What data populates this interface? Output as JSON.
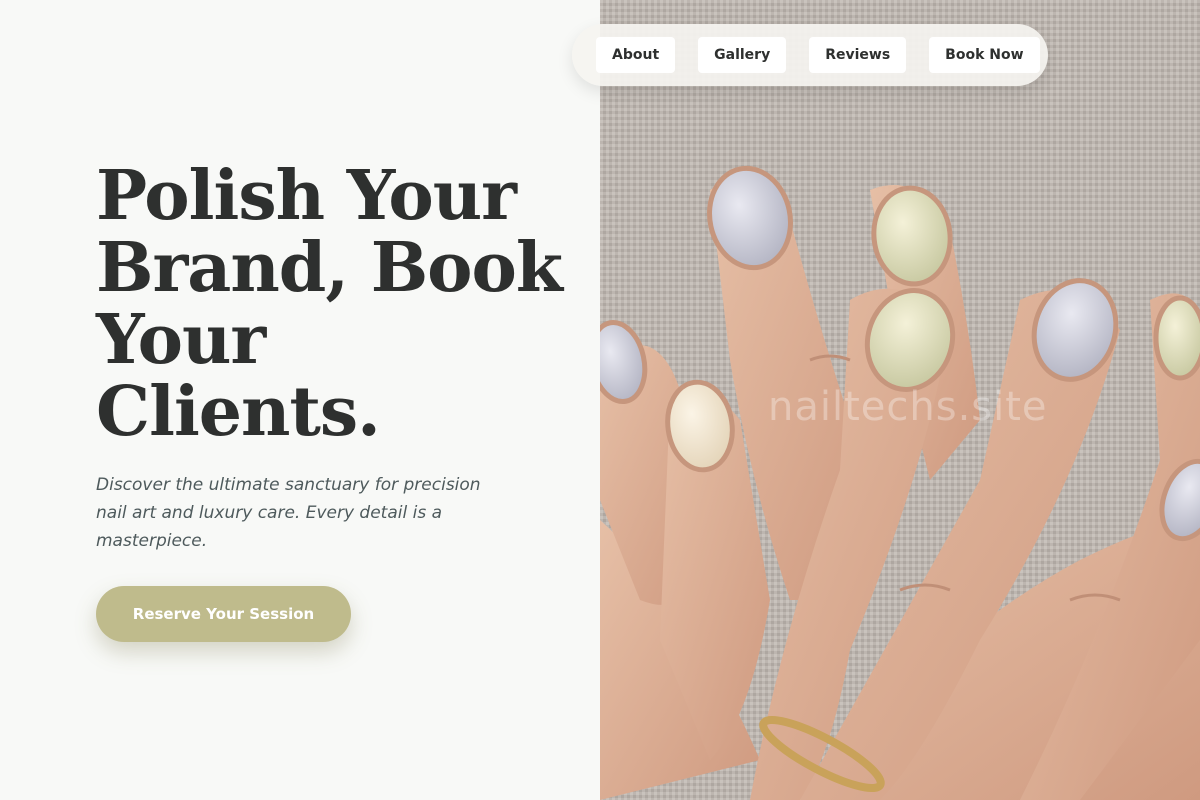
{
  "nav": {
    "links": [
      "About",
      "Gallery",
      "Reviews",
      "Book Now"
    ]
  },
  "hero": {
    "headline_lines": [
      "Polish Your",
      "Brand, Book",
      "Your",
      "Clients."
    ],
    "subtext": "Discover the ultimate sanctuary for precision nail art and luxury care. Every detail is a masterpiece.",
    "cta_label": "Reserve Your Session"
  },
  "image": {
    "subject": "hands-with-pastel-manicure-icon",
    "watermark": "nailtechs.site"
  },
  "colors": {
    "background": "#f8f9f7",
    "headline": "#2e302f",
    "subtext": "#4e5a5c",
    "accent": "#bfbb8c",
    "nav_bg": "#f5f4f0"
  }
}
